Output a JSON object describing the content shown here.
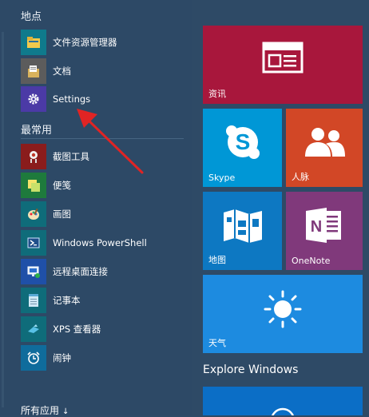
{
  "left_panel": {
    "places_header": "地点",
    "places": [
      {
        "label": "文件资源管理器",
        "icon": "folder-icon",
        "color": "#0f7a8c"
      },
      {
        "label": "文档",
        "icon": "documents-icon",
        "color": "#5c5c5c"
      },
      {
        "label": "Settings",
        "icon": "gear-icon",
        "color": "#4b3aa6"
      }
    ],
    "most_used_header": "最常用",
    "most_used": [
      {
        "label": "截图工具",
        "icon": "scissors-icon",
        "color": "#8a1c1c"
      },
      {
        "label": "便笺",
        "icon": "sticky-notes-icon",
        "color": "#1e7a3c"
      },
      {
        "label": "画图",
        "icon": "paint-icon",
        "color": "#0f6c7a"
      },
      {
        "label": "Windows PowerShell",
        "icon": "powershell-icon",
        "color": "#0f6c7a"
      },
      {
        "label": "远程桌面连接",
        "icon": "remote-desktop-icon",
        "color": "#1f50a8"
      },
      {
        "label": "记事本",
        "icon": "notepad-icon",
        "color": "#0f6c7a"
      },
      {
        "label": "XPS 查看器",
        "icon": "xps-viewer-icon",
        "color": "#0f6c7a"
      },
      {
        "label": "闹钟",
        "icon": "alarm-clock-icon",
        "color": "#0f6c9c"
      }
    ],
    "all_apps": "所有应用",
    "all_apps_arrow": "↓"
  },
  "tiles": {
    "news": {
      "label": "资讯",
      "color": "#a8173c",
      "icon": "news-icon"
    },
    "skype": {
      "label": "Skype",
      "color": "#0097d6",
      "icon": "skype-icon"
    },
    "people": {
      "label": "人脉",
      "color": "#d24726",
      "icon": "people-icon"
    },
    "maps": {
      "label": "地图",
      "color": "#0d78c2",
      "icon": "map-icon"
    },
    "onenote": {
      "label": "OneNote",
      "color": "#80397b",
      "icon": "onenote-icon"
    },
    "weather": {
      "label": "天气",
      "color": "#1d8be0",
      "icon": "sun-icon"
    },
    "explore_header": "Explore Windows",
    "explore_color": "#0b6ec6"
  },
  "annotation": {
    "color": "#e02424"
  }
}
